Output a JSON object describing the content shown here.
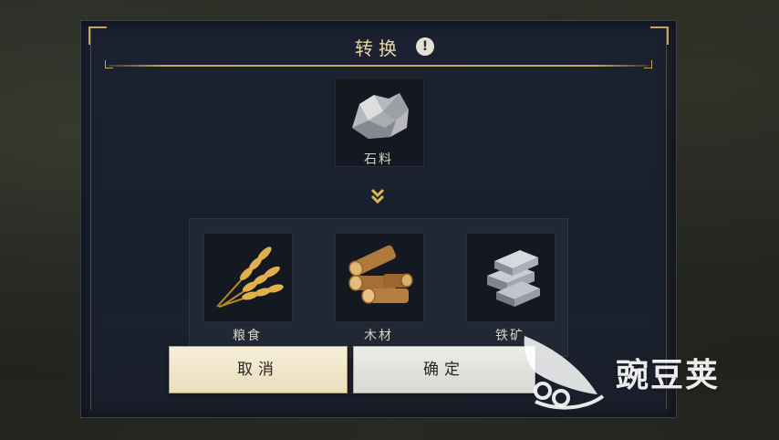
{
  "dialog": {
    "title": "转换",
    "info_icon": "!",
    "source": {
      "label": "石料",
      "icon": "stone-icon"
    },
    "outputs": [
      {
        "label": "粮食",
        "icon": "wheat-icon"
      },
      {
        "label": "木材",
        "icon": "wood-icon"
      },
      {
        "label": "铁矿",
        "icon": "iron-ingot-icon"
      }
    ],
    "cancel_label": "取消",
    "confirm_label": "确定"
  },
  "watermark": {
    "text": "豌豆荚"
  },
  "colors": {
    "accent_gold": "#c9a461",
    "panel_bg": "#1b2130",
    "button_cream": "#f3ead0"
  }
}
